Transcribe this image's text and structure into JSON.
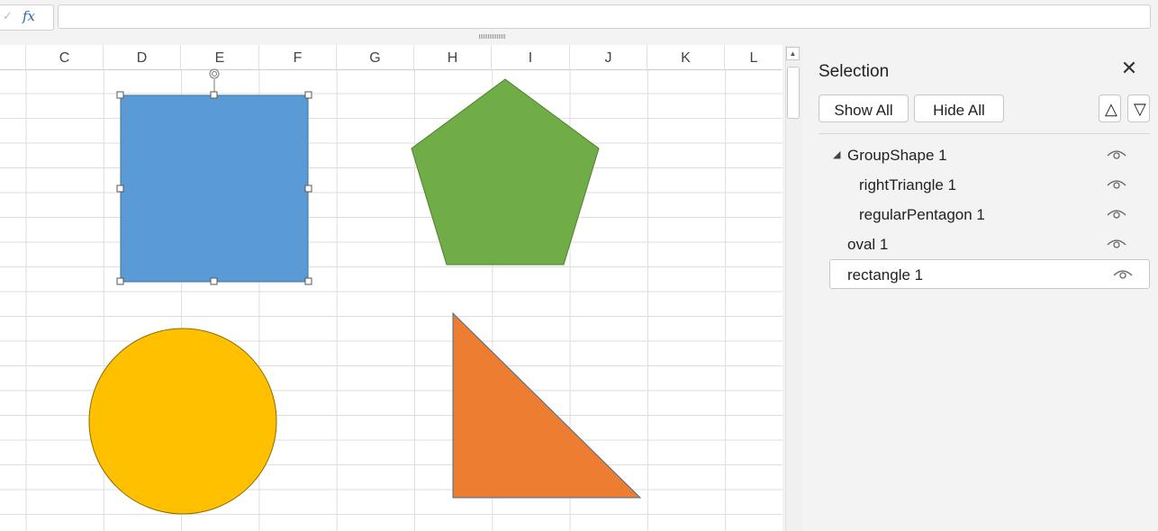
{
  "formula_bar": {
    "check_icon": "check-icon",
    "fx_label": "fx",
    "value": ""
  },
  "sheet": {
    "columns": [
      "C",
      "D",
      "E",
      "F",
      "G",
      "H",
      "I",
      "J",
      "K",
      "L"
    ],
    "shapes": {
      "rectangle": {
        "name": "rectangle 1",
        "fill": "#5b9bd5",
        "selected": true
      },
      "pentagon": {
        "name": "regularPentagon 1",
        "fill": "#70ad47"
      },
      "oval": {
        "name": "oval 1",
        "fill": "#ffc000"
      },
      "triangle": {
        "name": "rightTriangle 1",
        "fill": "#ed7d31"
      }
    }
  },
  "selection_pane": {
    "title": "Selection",
    "close_icon": "close-icon",
    "show_all_label": "Show All",
    "hide_all_label": "Hide All",
    "bring_forward_icon": "triangle-up-icon",
    "send_backward_icon": "triangle-down-icon",
    "items": [
      {
        "label": "GroupShape 1",
        "level": 0,
        "expanded": true,
        "visible": true
      },
      {
        "label": "rightTriangle 1",
        "level": 1,
        "visible": true
      },
      {
        "label": "regularPentagon 1",
        "level": 1,
        "visible": true
      },
      {
        "label": "oval 1",
        "level": 0,
        "visible": true
      },
      {
        "label": "rectangle 1",
        "level": 0,
        "visible": true,
        "selected": true
      }
    ]
  }
}
